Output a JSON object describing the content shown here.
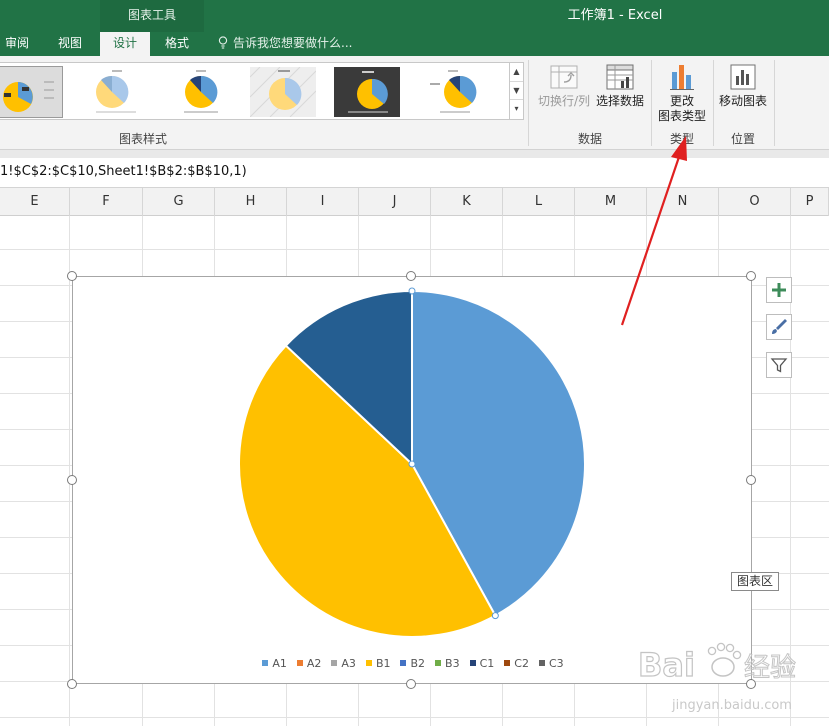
{
  "window": {
    "title": "工作簿1 - Excel",
    "context_group": "图表工具"
  },
  "tabs": [
    {
      "label": "审阅",
      "active": false
    },
    {
      "label": "视图",
      "active": false
    },
    {
      "label": "设计",
      "active": true
    },
    {
      "label": "格式",
      "active": false
    }
  ],
  "tell_me": {
    "placeholder": "告诉我您想要做什么..."
  },
  "ribbon": {
    "groups": {
      "chart_styles": "图表样式",
      "data": "数据",
      "type": "类型",
      "location": "位置"
    },
    "buttons": {
      "switch_row_col": "切换行/列",
      "select_data": "选择数据",
      "change_type_line1": "更改",
      "change_type_line2": "图表类型",
      "move_chart": "移动图表"
    }
  },
  "formula_bar": {
    "text": "1!$C$2:$C$10,Sheet1!$B$2:$B$10,1)"
  },
  "columns": [
    "E",
    "F",
    "G",
    "H",
    "I",
    "J",
    "K",
    "L",
    "M",
    "N",
    "O",
    "P"
  ],
  "chart": {
    "tooltip": "图表区",
    "legend": [
      {
        "label": "A1",
        "color": "#5b9bd5"
      },
      {
        "label": "A2",
        "color": "#ed7d31"
      },
      {
        "label": "A3",
        "color": "#a5a5a5"
      },
      {
        "label": "B1",
        "color": "#ffc000"
      },
      {
        "label": "B2",
        "color": "#4472c4"
      },
      {
        "label": "B3",
        "color": "#70ad47"
      },
      {
        "label": "C1",
        "color": "#264478"
      },
      {
        "label": "C2",
        "color": "#9e480e"
      },
      {
        "label": "C3",
        "color": "#636363"
      }
    ]
  },
  "chart_data": {
    "type": "pie",
    "categories": [
      "A1",
      "A2",
      "A3",
      "B1",
      "B2",
      "B3",
      "C1",
      "C2",
      "C3"
    ],
    "values": [
      42,
      0,
      0,
      45,
      0,
      0,
      13,
      0,
      0
    ],
    "slice_colors": [
      "#5b9bd5",
      "#ed7d31",
      "#a5a5a5",
      "#ffc000",
      "#4472c4",
      "#70ad47",
      "#255e91",
      "#9e480e",
      "#636363"
    ],
    "title": "",
    "legend_position": "bottom"
  },
  "watermark": {
    "brand": "Bai",
    "brand2": "经验",
    "url": "jingyan.baidu.com"
  }
}
